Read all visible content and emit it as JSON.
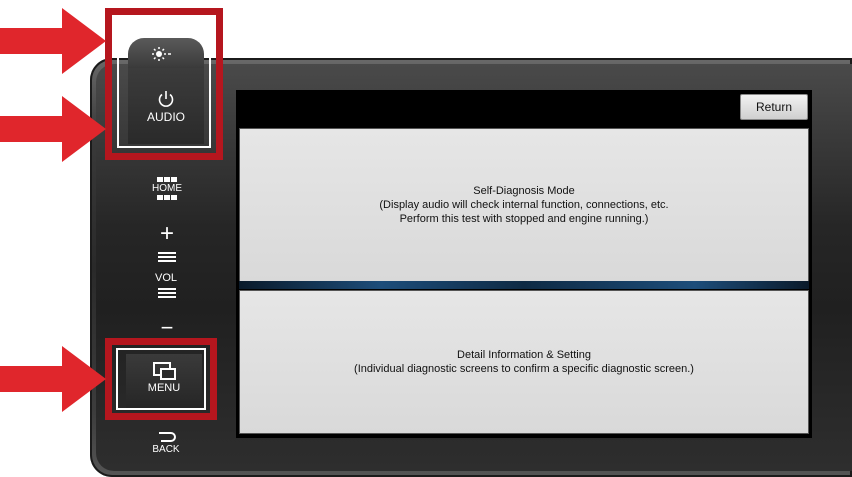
{
  "screen": {
    "return_label": "Return",
    "panels": [
      {
        "lines": [
          "Self-Diagnosis Mode",
          "(Display audio will check internal function, connections, etc.",
          "Perform this test with stopped and engine running.)"
        ]
      },
      {
        "lines": [
          "Detail Information & Setting",
          "(Individual diagnostic screens to confirm a specific diagnostic screen.)"
        ]
      }
    ]
  },
  "side_buttons": {
    "daynight_icon": "day-night-icon",
    "audio_label": "AUDIO",
    "home_label": "HOME",
    "vol_plus": "+",
    "vol_label": "VOL",
    "vol_minus": "−",
    "menu_label": "MENU",
    "back_label": "BACK"
  },
  "colors": {
    "highlight_red": "#b5161e",
    "arrow_red": "#e0262c"
  }
}
